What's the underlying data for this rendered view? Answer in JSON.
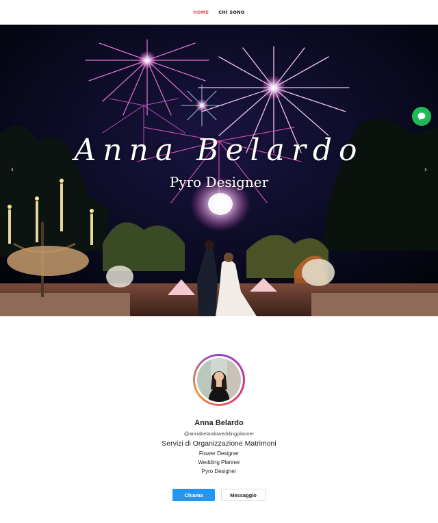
{
  "nav": {
    "items": [
      {
        "label": "HOME",
        "active": true
      },
      {
        "label": "CHI SONO",
        "active": false
      }
    ]
  },
  "hero": {
    "title": "Anna Belardo",
    "subtitle": "Pyro Designer",
    "prev_icon": "chevron-left-icon",
    "next_icon": "chevron-right-icon",
    "prev_glyph": "‹",
    "next_glyph": "›"
  },
  "chat": {
    "icon": "chat-bubble-icon",
    "color": "#1fb955"
  },
  "profile": {
    "name": "Anna Belardo",
    "handle": "@annabelardoweddingplanner",
    "headline": "Servizi di Organizzazione Matrimoni",
    "services": [
      "Flower Designer",
      "Wedding Planner",
      "Pyro Designer"
    ]
  },
  "actions": {
    "call_label": "Chiama",
    "message_label": "Messaggio"
  },
  "colors": {
    "nav_active": "#e0454a",
    "primary_button": "#2196f3"
  }
}
